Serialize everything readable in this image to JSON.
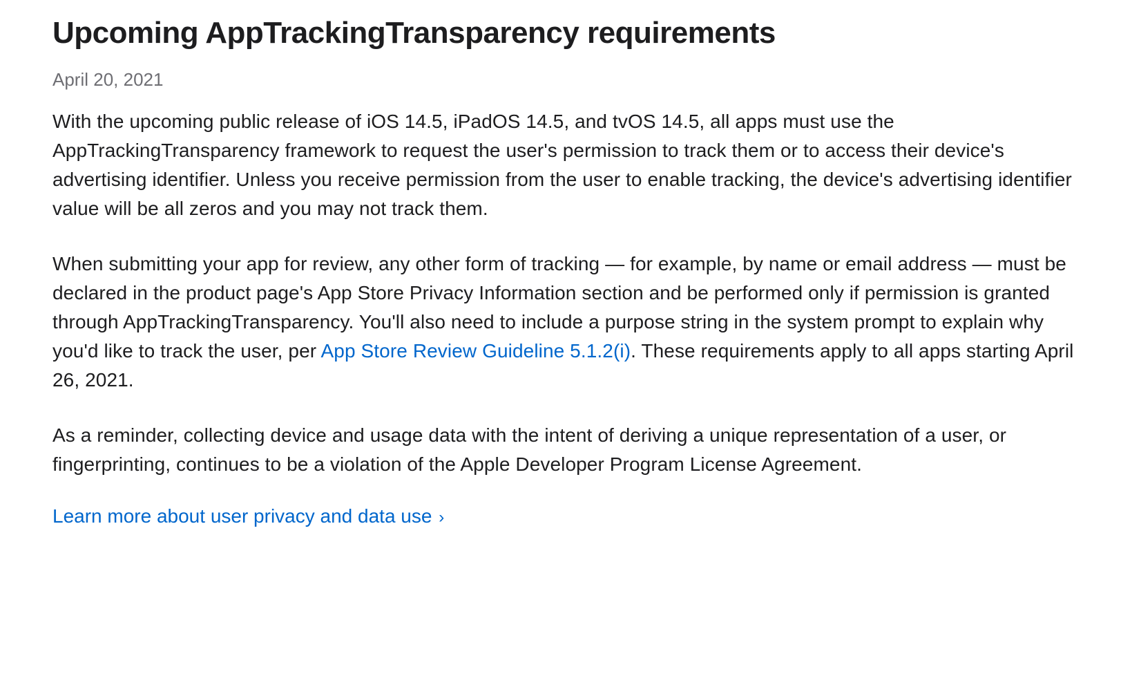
{
  "article": {
    "title": "Upcoming AppTrackingTransparency requirements",
    "date": "April 20, 2021",
    "paragraphs": {
      "p1": "With the upcoming public release of iOS 14.5, iPadOS 14.5, and tvOS 14.5, all apps must use the AppTrackingTransparency framework to request the user's permission to track them or to access their device's advertising identifier. Unless you receive permission from the user to enable tracking, the device's advertising identifier value will be all zeros and you may not track them.",
      "p2_before": "When submitting your app for review, any other form of tracking — for example, by name or email address — must be declared in the product page's App Store Privacy Information section and be performed only if permission is granted through AppTrackingTransparency. You'll also need to include a purpose string in the system prompt to explain why you'd like to track the user, per ",
      "p2_link": "App Store Review Guideline 5.1.2(i)",
      "p2_after": ". These requirements apply to all apps starting April 26, 2021.",
      "p3": "As a reminder, collecting device and usage data with the intent of deriving a unique representation of a user, or fingerprinting, continues to be a violation of the Apple Developer Program License Agreement."
    },
    "cta": {
      "label": "Learn more about user privacy and data use",
      "chevron": "›"
    }
  }
}
